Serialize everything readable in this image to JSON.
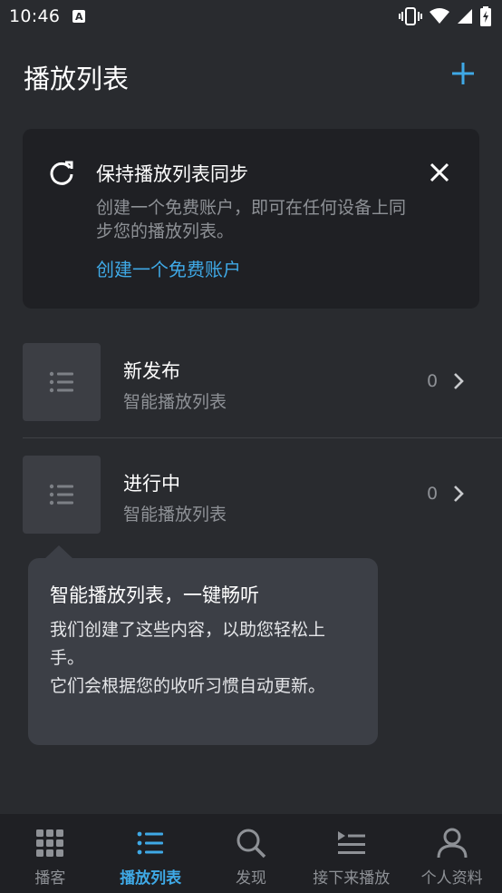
{
  "status_bar": {
    "time": "10:46",
    "notification_icon_letter": "A",
    "icons": [
      "vibrate-icon",
      "wifi-icon",
      "cell-signal-icon",
      "battery-charging-icon"
    ]
  },
  "header": {
    "title": "播放列表",
    "add_icon": "plus-icon"
  },
  "sync_card": {
    "title": "保持播放列表同步",
    "description": "创建一个免费账户，即可在任何设备上同步您的播放列表。",
    "link": "创建一个免费账户",
    "icons": [
      "refresh-icon",
      "close-icon"
    ]
  },
  "playlists": [
    {
      "name": "新发布",
      "type": "智能播放列表",
      "count": "0"
    },
    {
      "name": "进行中",
      "type": "智能播放列表",
      "count": "0"
    }
  ],
  "tooltip": {
    "title": "智能播放列表，一键畅听",
    "line1": "我们创建了这些内容，以助您轻松上手。",
    "line2": "它们会根据您的收听习惯自动更新。"
  },
  "bottom_nav": {
    "items": [
      {
        "label": "播客",
        "icon": "grid-icon",
        "active": false
      },
      {
        "label": "播放列表",
        "icon": "list-icon",
        "active": true
      },
      {
        "label": "发现",
        "icon": "search-icon",
        "active": false
      },
      {
        "label": "接下来播放",
        "icon": "up-next-icon",
        "active": false
      },
      {
        "label": "个人资料",
        "icon": "person-icon",
        "active": false
      }
    ]
  },
  "colors": {
    "background": "#292b2f",
    "card": "#1f2024",
    "accent": "#3fa9e6",
    "secondary_text": "#8e9196",
    "tooltip": "#3c3f46"
  }
}
